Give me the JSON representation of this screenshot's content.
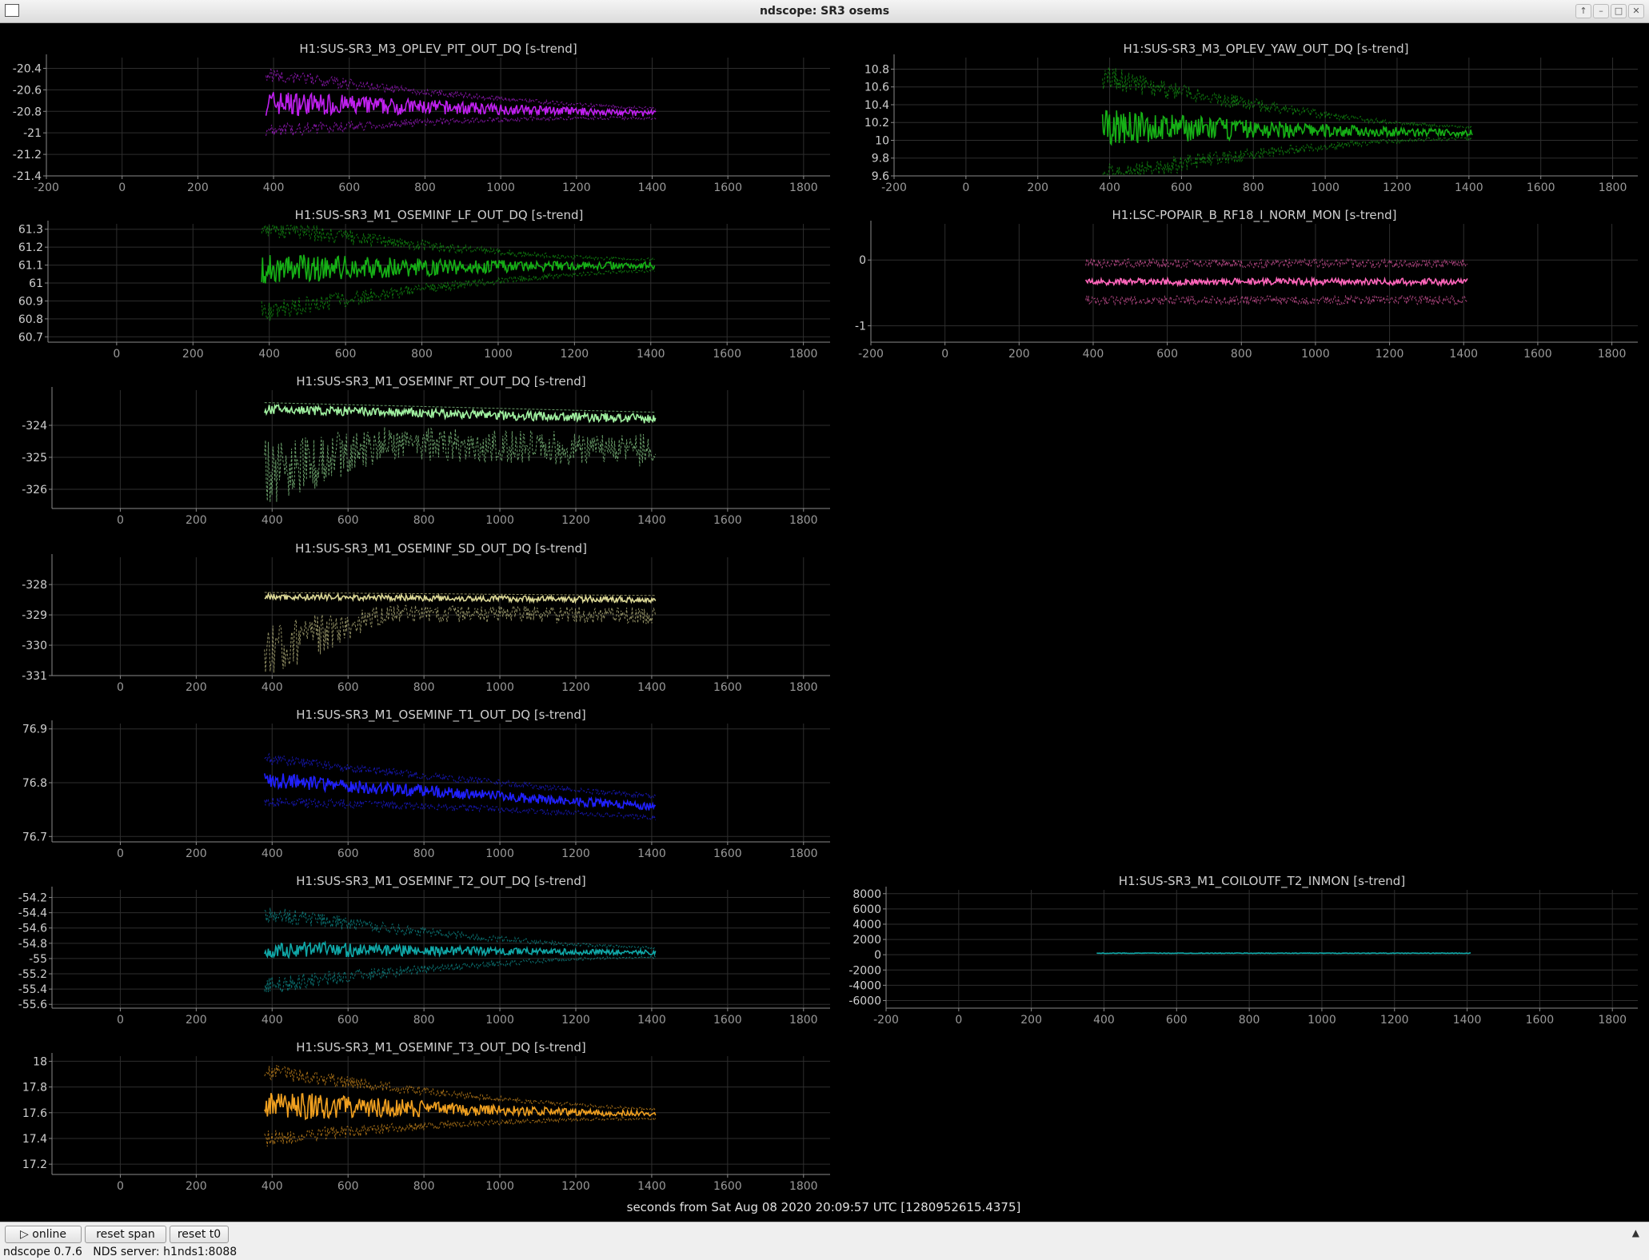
{
  "window": {
    "title": "ndscope: SR3 osems"
  },
  "footer_label": "seconds from Sat Aug 08 2020 20:09:57 UTC [1280952615.4375]",
  "toolbar": {
    "online": "online",
    "reset_span": "reset span",
    "reset_t0": "reset t0"
  },
  "status": {
    "version": "ndscope 0.7.6",
    "server": "NDS server: h1nds1:8088"
  },
  "colors": {
    "background": "#000000",
    "grid": "#2e2e2e",
    "axis": "#8a8a8a",
    "text": "#cfcfcf"
  },
  "chart_data": [
    {
      "type": "line",
      "title": "H1:SUS-SR3_M3_OPLEV_PIT_OUT_DQ [s-trend]",
      "color": "#c020f0",
      "x_ticks": [
        -200,
        0,
        200,
        400,
        600,
        800,
        1000,
        1200,
        1400,
        1600,
        1800
      ],
      "y_ticks": [
        -20.4,
        -20.6,
        -20.8,
        -21,
        -21.2,
        -21.4
      ],
      "xlim": [
        -200,
        1870
      ],
      "ylim": [
        -21.4,
        -20.3
      ],
      "series": {
        "x_range": [
          380,
          1410
        ],
        "mean": [
          -20.72,
          -20.82
        ],
        "band_inner": [
          0.12,
          0.03
        ],
        "band_outer": [
          0.33,
          0.06
        ]
      }
    },
    {
      "type": "line",
      "title": "H1:SUS-SR3_M3_OPLEV_YAW_OUT_DQ [s-trend]",
      "color": "#16b016",
      "x_ticks": [
        -200,
        0,
        200,
        400,
        600,
        800,
        1000,
        1200,
        1400,
        1600,
        1800
      ],
      "y_ticks": [
        10.8,
        10.6,
        10.4,
        10.2,
        10,
        9.8,
        9.6
      ],
      "xlim": [
        -200,
        1870
      ],
      "ylim": [
        9.6,
        10.93
      ],
      "series": {
        "x_range": [
          380,
          1410
        ],
        "mean": [
          10.15,
          10.08
        ],
        "band_inner": [
          0.2,
          0.04
        ],
        "band_outer": [
          0.7,
          0.08
        ]
      }
    },
    {
      "type": "line",
      "title": "H1:SUS-SR3_M1_OSEMINF_LF_OUT_DQ [s-trend]",
      "color": "#16b016",
      "x_ticks": [
        0,
        200,
        400,
        600,
        800,
        1000,
        1200,
        1400,
        1600,
        1800
      ],
      "y_ticks": [
        61.3,
        61.2,
        61.1,
        61,
        60.9,
        60.8,
        60.7
      ],
      "xlim": [
        -180,
        1870
      ],
      "ylim": [
        60.67,
        61.33
      ],
      "series": {
        "x_range": [
          380,
          1410
        ],
        "mean": [
          61.08,
          61.1
        ],
        "band_inner": [
          0.09,
          0.02
        ],
        "band_outer": [
          0.3,
          0.04
        ]
      }
    },
    {
      "type": "line",
      "title": "H1:LSC-POPAIR_B_RF18_I_NORM_MON [s-trend]",
      "color": "#ff66bb",
      "x_ticks": [
        -200,
        0,
        200,
        400,
        600,
        800,
        1000,
        1200,
        1400,
        1600,
        1800
      ],
      "y_ticks": [
        0,
        -1
      ],
      "xlim": [
        -200,
        1870
      ],
      "ylim": [
        -1.25,
        0.55
      ],
      "series": {
        "x_range": [
          380,
          1410
        ],
        "mean": [
          -0.33,
          -0.33
        ],
        "band_inner": [
          0.05,
          0.05
        ],
        "band_outer": [
          0.35,
          0.35
        ]
      }
    },
    {
      "type": "line",
      "title": "H1:SUS-SR3_M1_OSEMINF_RT_OUT_DQ [s-trend]",
      "color": "#a0f0a0",
      "x_ticks": [
        0,
        200,
        400,
        600,
        800,
        1000,
        1200,
        1400,
        1600,
        1800
      ],
      "y_ticks": [
        -324,
        -325,
        -326
      ],
      "xlim": [
        -180,
        1870
      ],
      "ylim": [
        -326.6,
        -322.9
      ],
      "series": {
        "x_range": [
          380,
          1410
        ],
        "mean": [
          -323.5,
          -323.8
        ],
        "band_inner": [
          0.15,
          0.15
        ],
        "band_outer": [
          0,
          0
        ],
        "dip": [
          -1.5,
          -3.2
        ]
      }
    },
    {
      "type": "line",
      "title": "H1:SUS-SR3_M1_OSEMINF_SD_OUT_DQ [s-trend]",
      "color": "#dcd896",
      "x_ticks": [
        0,
        200,
        400,
        600,
        800,
        1000,
        1200,
        1400,
        1600,
        1800
      ],
      "y_ticks": [
        -328,
        -329,
        -330,
        -331
      ],
      "xlim": [
        -180,
        1870
      ],
      "ylim": [
        -331,
        -327.1
      ],
      "series": {
        "x_range": [
          380,
          1410
        ],
        "mean": [
          -328.4,
          -328.5
        ],
        "band_inner": [
          0.1,
          0.1
        ],
        "band_outer": [
          0,
          0
        ],
        "dip": [
          -0.8,
          -2.8
        ]
      }
    },
    {
      "type": "line",
      "title": "H1:SUS-SR3_M1_OSEMINF_T1_OUT_DQ [s-trend]",
      "color": "#2020ff",
      "x_ticks": [
        0,
        200,
        400,
        600,
        800,
        1000,
        1200,
        1400,
        1600,
        1800
      ],
      "y_ticks": [
        76.9,
        76.8,
        76.7
      ],
      "xlim": [
        -180,
        1870
      ],
      "ylim": [
        76.69,
        76.91
      ],
      "series": {
        "x_range": [
          380,
          1410
        ],
        "mean": [
          76.805,
          76.755
        ],
        "band_inner": [
          0.015,
          0.008
        ],
        "band_outer": [
          0.05,
          0.025
        ]
      }
    },
    {
      "type": "line",
      "title": "H1:SUS-SR3_M1_OSEMINF_T2_OUT_DQ [s-trend]",
      "color": "#10a8a8",
      "x_ticks": [
        0,
        200,
        400,
        600,
        800,
        1000,
        1200,
        1400,
        1600,
        1800
      ],
      "y_ticks": [
        -54.2,
        -54.4,
        -54.6,
        -54.8,
        -55,
        -55.2,
        -55.4,
        -55.6
      ],
      "xlim": [
        -180,
        1870
      ],
      "ylim": [
        -55.65,
        -54.1
      ],
      "series": {
        "x_range": [
          380,
          1410
        ],
        "mean": [
          -54.88,
          -54.92
        ],
        "band_inner": [
          0.12,
          0.03
        ],
        "band_outer": [
          0.6,
          0.08
        ]
      }
    },
    {
      "type": "line",
      "title": "H1:SUS-SR3_M1_COILOUTF_T2_INMON [s-trend]",
      "color": "#10a8a8",
      "x_ticks": [
        -200,
        0,
        200,
        400,
        600,
        800,
        1000,
        1200,
        1400,
        1600,
        1800
      ],
      "y_ticks": [
        8000,
        6000,
        4000,
        2000,
        0,
        -2000,
        -4000,
        -6000
      ],
      "xlim": [
        -200,
        1870
      ],
      "ylim": [
        -7000,
        8500
      ],
      "series": {
        "x_range": [
          380,
          1410
        ],
        "mean": [
          200,
          200
        ],
        "band_inner": [
          40,
          40
        ],
        "band_outer": [
          0,
          0
        ]
      }
    },
    {
      "type": "line",
      "title": "H1:SUS-SR3_M1_OSEMINF_T3_OUT_DQ [s-trend]",
      "color": "#f0a020",
      "x_ticks": [
        0,
        200,
        400,
        600,
        800,
        1000,
        1200,
        1400,
        1600,
        1800
      ],
      "y_ticks": [
        18,
        17.8,
        17.6,
        17.4,
        17.2
      ],
      "xlim": [
        -180,
        1870
      ],
      "ylim": [
        17.12,
        18.04
      ],
      "series": {
        "x_range": [
          380,
          1410
        ],
        "mean": [
          17.66,
          17.59
        ],
        "band_inner": [
          0.12,
          0.02
        ],
        "band_outer": [
          0.33,
          0.05
        ]
      }
    }
  ]
}
